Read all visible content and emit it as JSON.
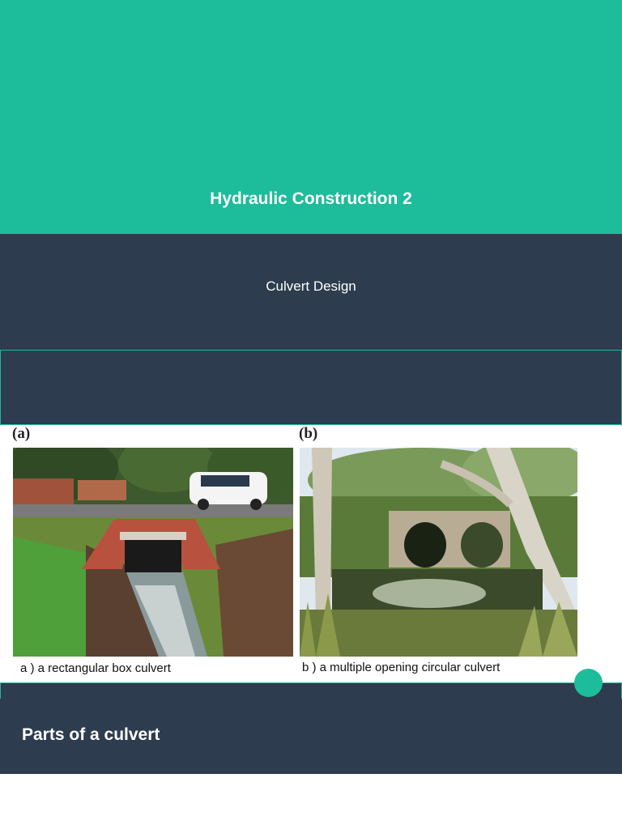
{
  "slide": {
    "title": "Hydraulic Construction 2",
    "subtitle": "Culvert Design"
  },
  "figure": {
    "a": {
      "letter": "(a)",
      "caption": "a ) a rectangular box culvert",
      "image": "photo of a rectangular box culvert"
    },
    "b": {
      "letter": "(b)",
      "caption": "b ) a multiple opening circular culvert",
      "image": "photo of a multiple opening circular culvert"
    }
  },
  "section": {
    "title": "Parts of a culvert"
  },
  "colors": {
    "teal": "#1dbc9a",
    "navy": "#2d3c4e"
  }
}
